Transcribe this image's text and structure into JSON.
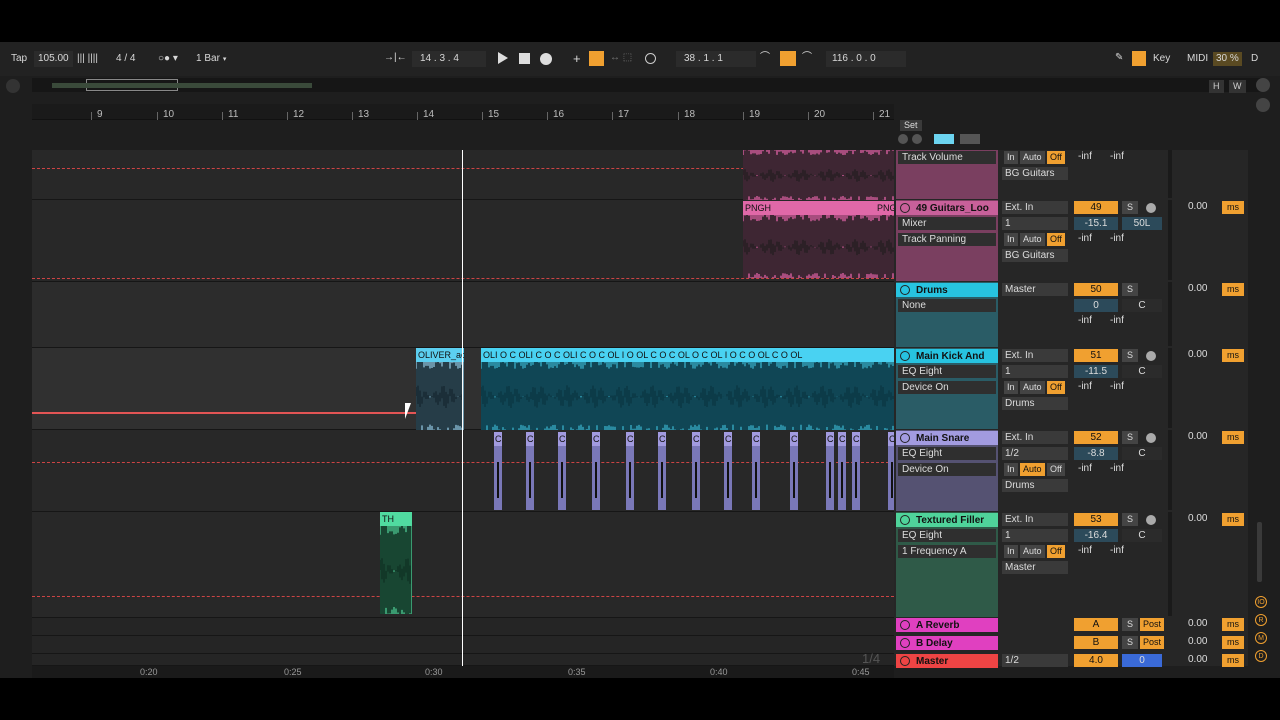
{
  "transport": {
    "tap": "Tap",
    "tempo": "105.00",
    "meter": "4 / 4",
    "quant": "1 Bar",
    "position": "14 .  3 .  4",
    "loop_start": "38 .  1 .  1",
    "loop_length": "116 .  0 .  0",
    "key": "Key",
    "midi": "MIDI",
    "cpu": "30 %",
    "d": "D"
  },
  "overview": {
    "h": "H",
    "w": "W"
  },
  "ruler": {
    "bars": [
      "9",
      "10",
      "11",
      "12",
      "13",
      "14",
      "15",
      "16",
      "17",
      "18",
      "19",
      "20",
      "21"
    ]
  },
  "timeline": {
    "times": [
      "0:20",
      "0:25",
      "0:30",
      "0:35",
      "0:40",
      "0:45"
    ],
    "page": "1/4"
  },
  "set_label": "Set",
  "clips": {
    "pngh1": "PNGH",
    "pngh2": "PNG",
    "oliver": "OLIVER_ac",
    "oli": "OLI O C OLI C O C OLI C O C OL I O OL C O C OL O C OL I O C O OL C O OL",
    "th": "TH",
    "c": "C"
  },
  "mixer": {
    "colors": {
      "pink": "#c8609a",
      "cyan": "#27c3e0",
      "lilac": "#a29be0",
      "green": "#4fd39a",
      "magenta": "#e040c0",
      "red": "#ee4444"
    },
    "tracks": [
      {
        "name": "",
        "dev1": "Track Volume",
        "in": "In",
        "auto": "Auto",
        "off": "Off",
        "out": "BG Guitars",
        "num": "",
        "vol": "-inf",
        "pan": "-inf"
      },
      {
        "name": "49 Guitars_Loo",
        "dev1": "Mixer",
        "dev2": "Track Panning",
        "io": "Ext. In",
        "ch": "1",
        "in": "In",
        "auto": "Auto",
        "off": "Off",
        "out": "BG Guitars",
        "num": "49",
        "s": "S",
        "vol": "-15.1",
        "pan": "50L",
        "inf1": "-inf",
        "inf2": "-inf",
        "delay": "0.00",
        "ms": "ms"
      },
      {
        "name": "Drums",
        "dev1": "None",
        "io": "Master",
        "num": "50",
        "s": "S",
        "vol": "0",
        "pan": "C",
        "inf1": "-inf",
        "inf2": "-inf",
        "delay": "0.00",
        "ms": "ms"
      },
      {
        "name": "Main Kick And",
        "dev1": "EQ Eight",
        "dev2": "Device On",
        "io": "Ext. In",
        "ch": "1",
        "in": "In",
        "auto": "Auto",
        "off": "Off",
        "out": "Drums",
        "num": "51",
        "s": "S",
        "vol": "-11.5",
        "pan": "C",
        "inf1": "-inf",
        "inf2": "-inf",
        "delay": "0.00",
        "ms": "ms"
      },
      {
        "name": "Main Snare",
        "dev1": "EQ Eight",
        "dev2": "Device On",
        "io": "Ext. In",
        "ch": "1/2",
        "in": "In",
        "auto": "Auto",
        "off": "Off",
        "out": "Drums",
        "num": "52",
        "s": "S",
        "vol": "-8.8",
        "pan": "C",
        "inf1": "-inf",
        "inf2": "-inf",
        "delay": "0.00",
        "ms": "ms"
      },
      {
        "name": "Textured Filler",
        "dev1": "EQ Eight",
        "dev2": "1 Frequency A",
        "io": "Ext. In",
        "ch": "1",
        "in": "In",
        "auto": "Auto",
        "off": "Off",
        "out": "Master",
        "num": "53",
        "s": "S",
        "vol": "-16.4",
        "pan": "C",
        "inf1": "-inf",
        "inf2": "-inf",
        "delay": "0.00",
        "ms": "ms"
      }
    ],
    "returns": [
      {
        "name": "A Reverb",
        "num": "A",
        "s": "S",
        "post": "Post",
        "delay": "0.00",
        "ms": "ms"
      },
      {
        "name": "B Delay",
        "num": "B",
        "s": "S",
        "post": "Post",
        "delay": "0.00",
        "ms": "ms"
      },
      {
        "name": "Master",
        "ch": "1/2",
        "num": "4.0",
        "pan": "0",
        "delay": "0.00",
        "ms": "ms"
      }
    ]
  },
  "side_icons": [
    "IO",
    "R",
    "M",
    "D"
  ]
}
